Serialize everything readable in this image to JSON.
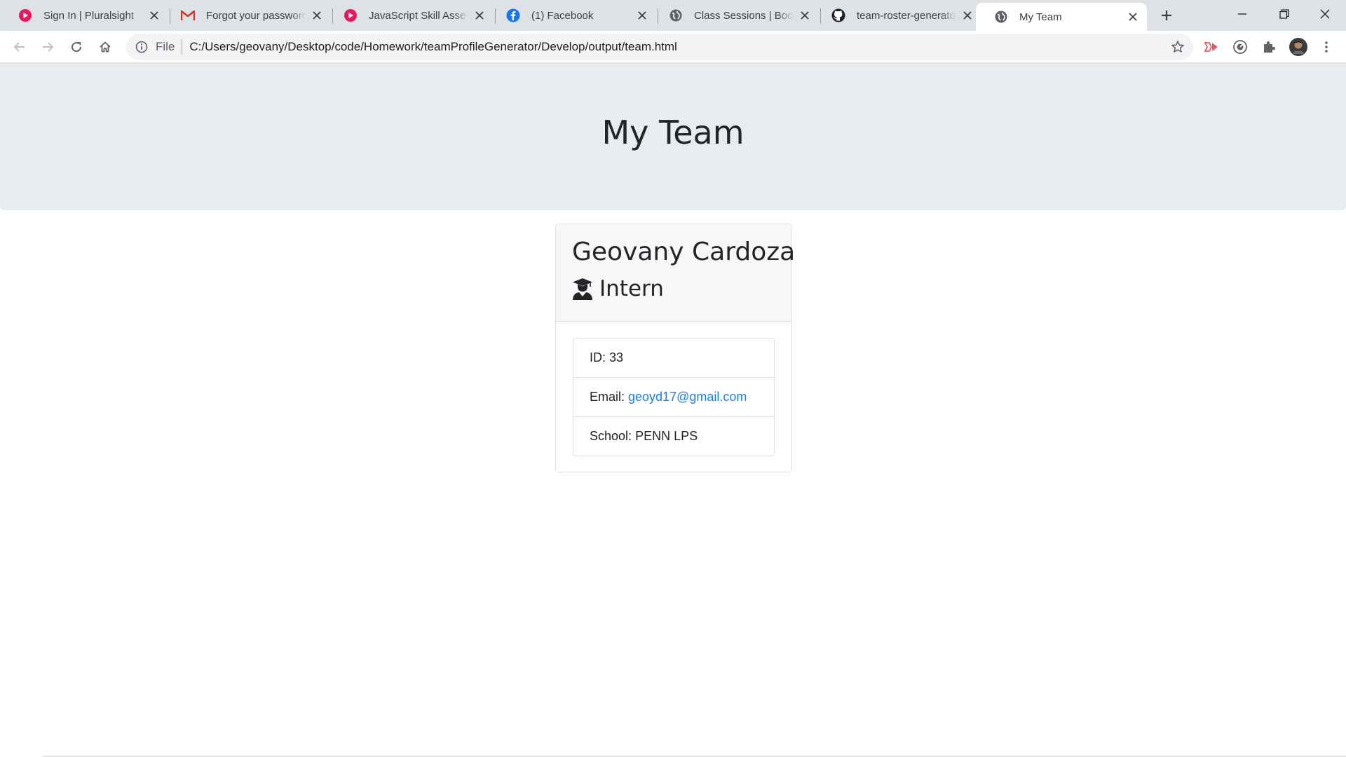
{
  "browser": {
    "tabs": [
      {
        "title": "Sign In | Pluralsight",
        "icon": "pluralsight-icon",
        "active": false
      },
      {
        "title": "Forgot your password",
        "icon": "gmail-icon",
        "active": false
      },
      {
        "title": "JavaScript Skill Assessment",
        "icon": "pluralsight-icon",
        "active": false
      },
      {
        "title": "(1) Facebook",
        "icon": "facebook-icon",
        "active": false
      },
      {
        "title": "Class Sessions | Bootcamp",
        "icon": "globe-icon",
        "active": false
      },
      {
        "title": "team-roster-generator",
        "icon": "github-icon",
        "active": false
      },
      {
        "title": "My Team",
        "icon": "globe-icon",
        "active": true
      }
    ],
    "address": {
      "scheme_label": "File",
      "url": "C:/Users/geovany/Desktop/code/Homework/teamProfileGenerator/Develop/output/team.html"
    },
    "colors": {
      "tabstrip": "#dee1e6",
      "omnibox": "#f1f3f4"
    }
  },
  "page": {
    "header": {
      "title": "My Team"
    },
    "employee": {
      "name": "Geovany Cardoza",
      "role": "Intern",
      "role_icon": "graduate-icon",
      "id_label": "ID:",
      "id_value": "33",
      "email_label": "Email:",
      "email_value": "geoyd17@gmail.com",
      "school_label": "School:",
      "school_value": "PENN LPS"
    },
    "colors": {
      "jumbotron": "#e9ecef",
      "link": "#1a7fe0",
      "text": "#212529"
    }
  }
}
